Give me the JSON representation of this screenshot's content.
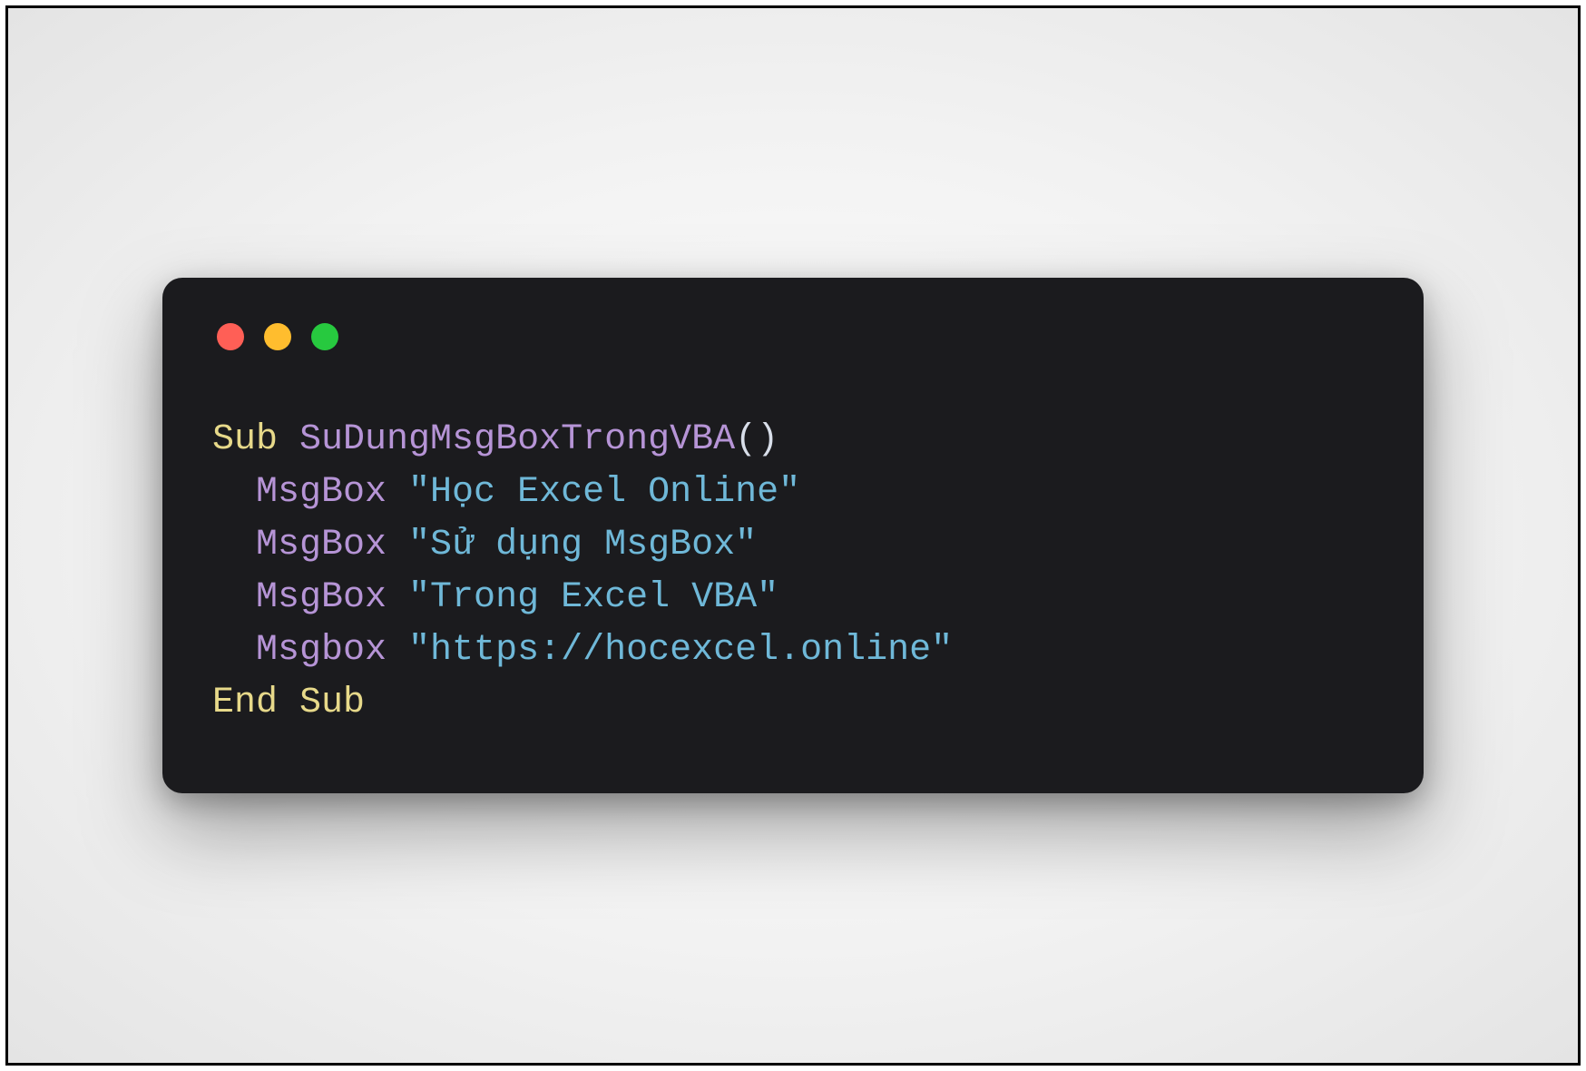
{
  "window": {
    "traffic_lights": {
      "red": "#ff5f56",
      "yellow": "#ffbd2e",
      "green": "#27c93f"
    }
  },
  "code": {
    "kw_sub": "Sub",
    "proc_name": "SuDungMsgBoxTrongVBA",
    "paren_open": "(",
    "paren_close": ")",
    "lines": [
      {
        "call": "MsgBox",
        "arg": "\"Học Excel Online\""
      },
      {
        "call": "MsgBox",
        "arg": "\"Sử dụng MsgBox\""
      },
      {
        "call": "MsgBox",
        "arg": "\"Trong Excel VBA\""
      },
      {
        "call": "Msgbox",
        "arg": "\"https://hocexcel.online\""
      }
    ],
    "kw_end_sub": "End Sub"
  }
}
